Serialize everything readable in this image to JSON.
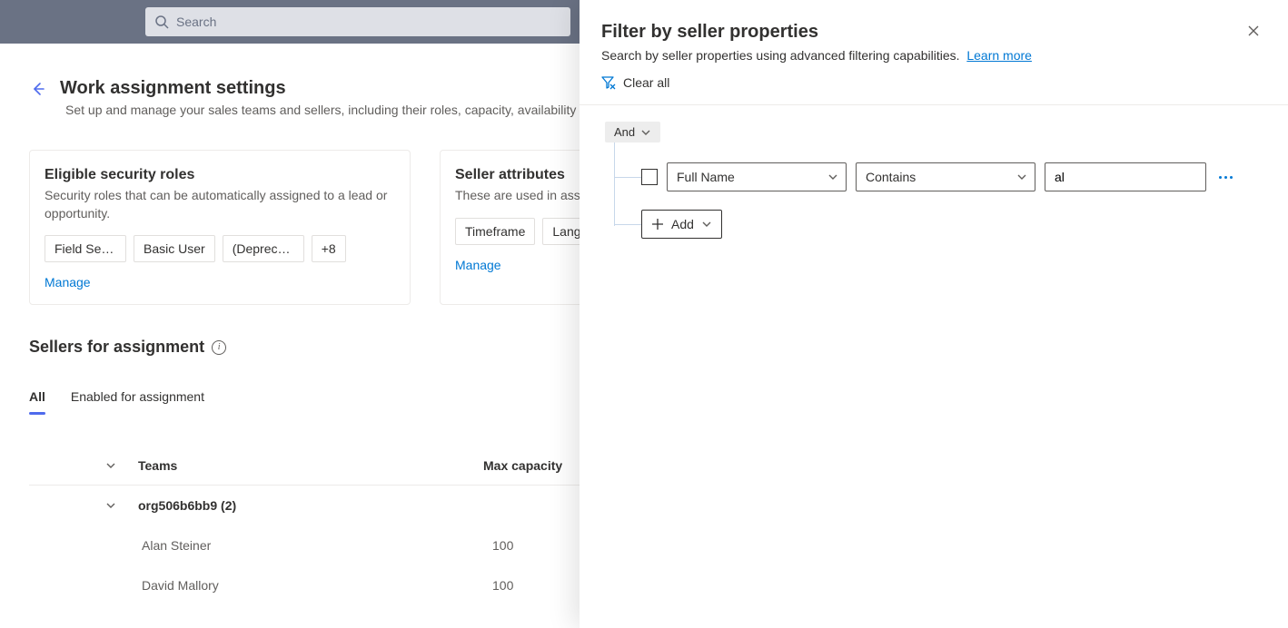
{
  "header": {
    "search_placeholder": "Search"
  },
  "page": {
    "title": "Work assignment settings",
    "subtitle": "Set up and manage your sales teams and sellers, including their roles, capacity, availability a"
  },
  "card_roles": {
    "title": "Eligible security roles",
    "desc": "Security roles that can be automatically assigned to a lead or opportunity.",
    "chips": [
      "Field Servic...",
      "Basic User",
      "(Deprecate...",
      "+8"
    ],
    "manage": "Manage"
  },
  "card_attrs": {
    "title": "Seller attributes",
    "desc": "These are used in assign",
    "chips": [
      "Timeframe",
      "Langua"
    ],
    "manage": "Manage"
  },
  "section": {
    "title": "Sellers for assignment"
  },
  "tabs": {
    "all": "All",
    "enabled": "Enabled for assignment"
  },
  "grid": {
    "head_teams": "Teams",
    "head_capacity": "Max capacity",
    "group": "org506b6bb9 (2)",
    "rows": [
      {
        "name": "Alan Steiner",
        "capacity": "100"
      },
      {
        "name": "David Mallory",
        "capacity": "100"
      }
    ]
  },
  "panel": {
    "title": "Filter by seller properties",
    "subtitle": "Search by seller properties using advanced filtering capabilities.",
    "learn_more": "Learn more",
    "clear_all": "Clear all",
    "and_label": "And",
    "field_label": "Full Name",
    "operator_label": "Contains",
    "value": "al",
    "add_label": "Add"
  }
}
